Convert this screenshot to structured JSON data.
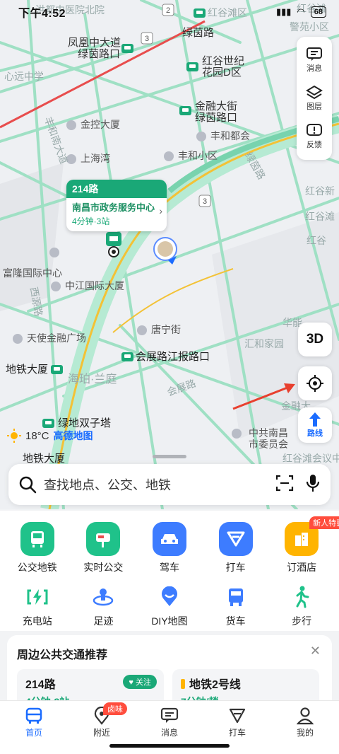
{
  "status": {
    "time": "下午4:52",
    "battery": "68"
  },
  "map": {
    "labels": [
      {
        "text": "洪都中医院北院",
        "kind": "faint"
      },
      {
        "text": "红谷滩区",
        "kind": "faint"
      },
      {
        "text": "红谷滩",
        "kind": "faint"
      },
      {
        "text": "警苑小区",
        "kind": "faint"
      },
      {
        "text": "凤凰中大道",
        "kind": "green"
      },
      {
        "text": "绿茵路口",
        "kind": "green"
      },
      {
        "text": "绿茵路",
        "kind": "green"
      },
      {
        "text": "红谷世纪",
        "kind": "green"
      },
      {
        "text": "花园D区",
        "kind": "green"
      },
      {
        "text": "心远中学",
        "kind": "faint"
      },
      {
        "text": "金融大街",
        "kind": "green"
      },
      {
        "text": "绿茵路口",
        "kind": "green"
      },
      {
        "text": "金控大厦",
        "kind": "poi"
      },
      {
        "text": "丰和都会",
        "kind": "poi"
      },
      {
        "text": "上海湾",
        "kind": "poi"
      },
      {
        "text": "丰和小区",
        "kind": "poi"
      },
      {
        "text": "丰和南大道",
        "kind": "faint"
      },
      {
        "text": "绿茵路",
        "kind": "faint"
      },
      {
        "text": "红谷新",
        "kind": "faint"
      },
      {
        "text": "红谷滩",
        "kind": "faint"
      },
      {
        "text": "红谷",
        "kind": "faint"
      },
      {
        "text": "富隆国际中心",
        "kind": "poi"
      },
      {
        "text": "中江国际大厦",
        "kind": "poi"
      },
      {
        "text": "西源路",
        "kind": "faint"
      },
      {
        "text": "唐宁街",
        "kind": "poi"
      },
      {
        "text": "华能",
        "kind": "faint"
      },
      {
        "text": "汇和家园",
        "kind": "faint"
      },
      {
        "text": "天使金融广场",
        "kind": "poi"
      },
      {
        "text": "会展路江报路口",
        "kind": "dark"
      },
      {
        "text": "地铁大厦",
        "kind": "dark"
      },
      {
        "text": "海珀·兰庭",
        "kind": "faint"
      },
      {
        "text": "会展路",
        "kind": "faint"
      },
      {
        "text": "金融大",
        "kind": "faint"
      },
      {
        "text": "绿地双子塔",
        "kind": "dark"
      },
      {
        "text": "中共南昌",
        "kind": "poi"
      },
      {
        "text": "市委员会",
        "kind": "poi"
      },
      {
        "text": "地铁大厦",
        "kind": "dark"
      },
      {
        "text": "红谷滩会议中",
        "kind": "faint"
      }
    ],
    "road_numbers": [
      "2",
      "3",
      "3"
    ],
    "route_card": {
      "route": "214路",
      "stop": "南昌市政务服务中心",
      "eta": "4分钟·3站"
    },
    "weather": {
      "temp": "18°C",
      "logo": "高德地图"
    }
  },
  "controls": {
    "items": [
      {
        "label": "消息",
        "icon": "message-icon"
      },
      {
        "label": "图层",
        "icon": "layers-icon"
      },
      {
        "label": "反馈",
        "icon": "feedback-icon"
      }
    ],
    "btn_3d": "3D",
    "route_label": "路线"
  },
  "search": {
    "placeholder": "查找地点、公交、地铁"
  },
  "grid": {
    "row1": [
      {
        "label": "公交地铁",
        "icon": "bus-metro-icon",
        "color": "#1fc28a"
      },
      {
        "label": "实时公交",
        "icon": "realtime-bus-icon",
        "color": "#1fc28a"
      },
      {
        "label": "驾车",
        "icon": "car-icon",
        "color": "#3d7cff"
      },
      {
        "label": "打车",
        "icon": "taxi-icon",
        "color": "#3d7cff"
      },
      {
        "label": "订酒店",
        "icon": "hotel-icon",
        "color": "#ffb400",
        "badge": "新人特惠"
      }
    ],
    "row2": [
      {
        "label": "充电站",
        "icon": "charging-icon"
      },
      {
        "label": "足迹",
        "icon": "footprint-icon"
      },
      {
        "label": "DIY地图",
        "icon": "diy-map-icon"
      },
      {
        "label": "货车",
        "icon": "truck-icon"
      },
      {
        "label": "步行",
        "icon": "walk-icon"
      }
    ]
  },
  "transit": {
    "title": "周边公共交通推荐",
    "cards": [
      {
        "name": "214路",
        "eta": "4分钟·3站",
        "follow": "关注"
      },
      {
        "name": "地铁2号线",
        "eta": "7分钟/趟"
      }
    ]
  },
  "tabs": [
    {
      "label": "首页",
      "icon": "home-icon",
      "active": true
    },
    {
      "label": "附近",
      "icon": "nearby-icon",
      "badge": "卤味"
    },
    {
      "label": "消息",
      "icon": "message-icon"
    },
    {
      "label": "打车",
      "icon": "taxi-icon"
    },
    {
      "label": "我的",
      "icon": "profile-icon"
    }
  ],
  "colors": {
    "brand": "#1b6cff",
    "transit_green": "#1aa877",
    "badge_red": "#ff4d3d"
  }
}
